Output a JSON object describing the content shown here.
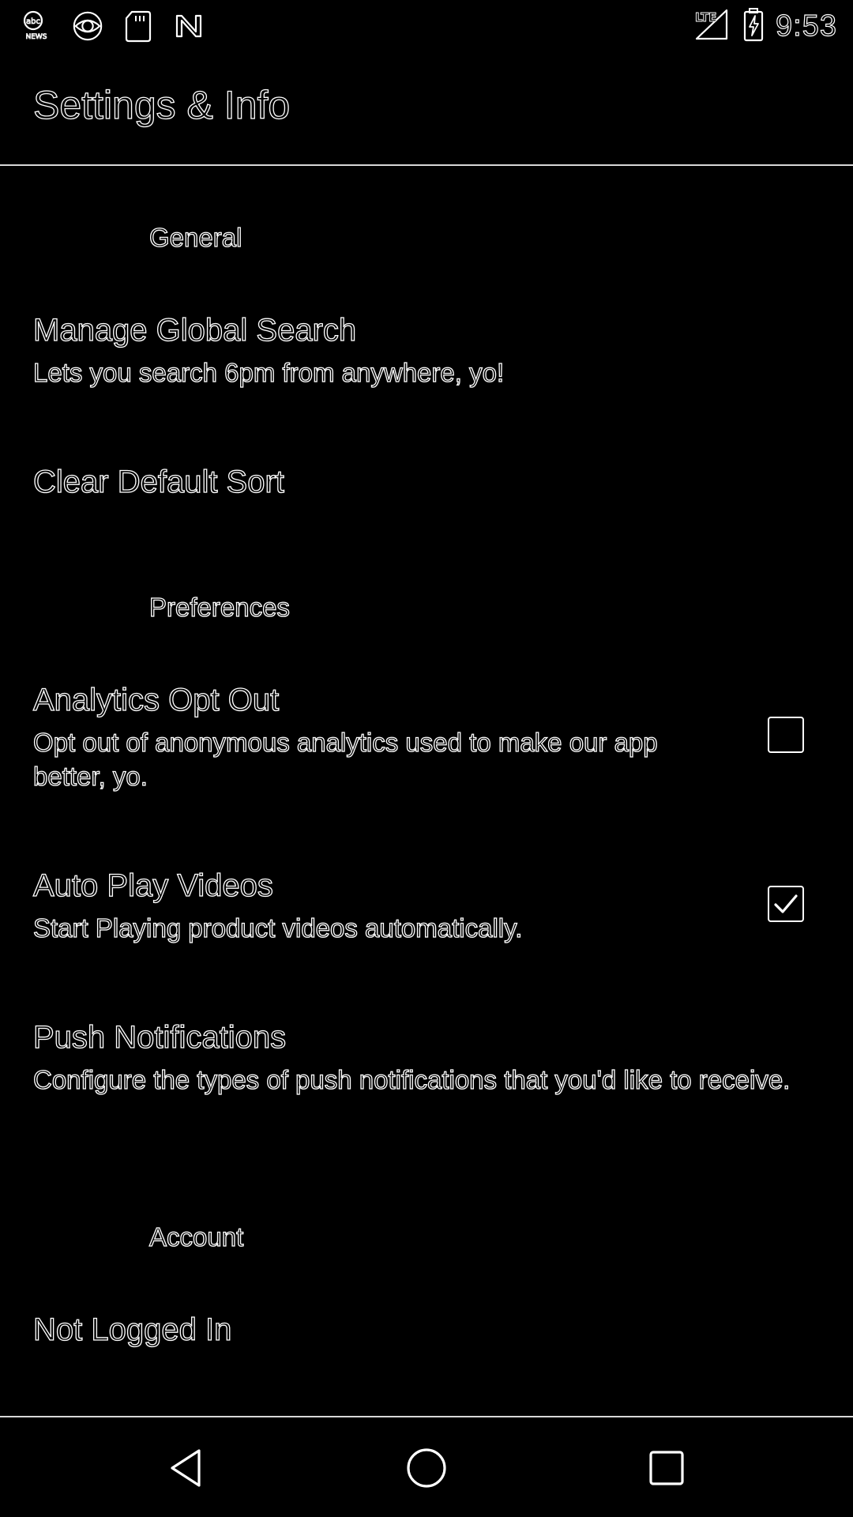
{
  "status_bar": {
    "time": "9:53",
    "left_icons": [
      "abc-news-icon",
      "cbs-icon",
      "sd-card-icon",
      "n-icon"
    ],
    "network_label": "LTE"
  },
  "toolbar": {
    "title": "Settings & Info"
  },
  "sections": {
    "general": {
      "header": "General",
      "manage_global_search": {
        "title": "Manage Global Search",
        "summary": "Lets you search 6pm from anywhere, yo!"
      },
      "clear_default_sort": {
        "title": "Clear Default Sort"
      }
    },
    "preferences": {
      "header": "Preferences",
      "analytics_opt_out": {
        "title": "Analytics Opt Out",
        "summary": "Opt out of anonymous analytics used to make our app better, yo.",
        "checked": false
      },
      "auto_play_videos": {
        "title": "Auto Play Videos",
        "summary": "Start Playing product videos automatically.",
        "checked": true
      },
      "push_notifications": {
        "title": "Push Notifications",
        "summary": "Configure the types of push notifications that you'd like to receive."
      }
    },
    "account": {
      "header": "Account",
      "login_status": {
        "title": "Not Logged In"
      }
    }
  },
  "nav_bar": {
    "icons": [
      "back-icon",
      "home-icon",
      "recents-icon"
    ]
  },
  "colors": {
    "background": "#000000",
    "outline": "#ffffff",
    "divider": "#d8d8d8"
  }
}
